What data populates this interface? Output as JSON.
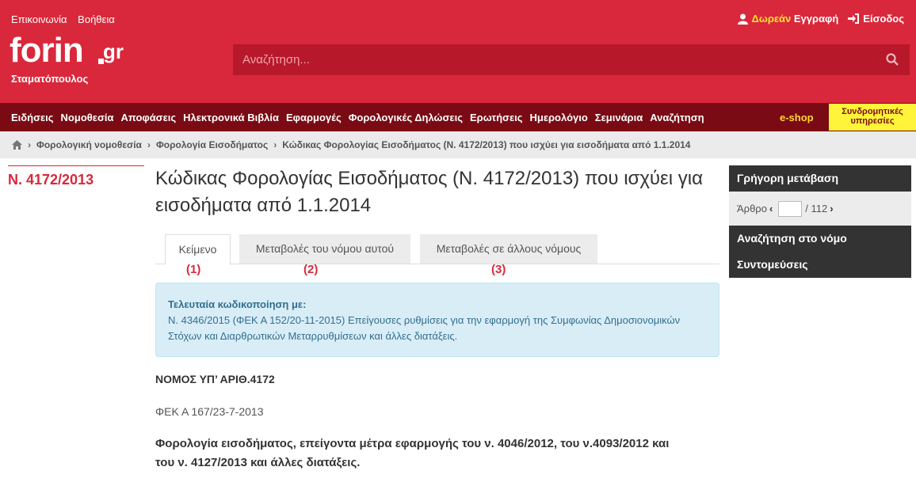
{
  "header": {
    "top_links": [
      "Επικοινωνία",
      "Βοήθεια"
    ],
    "register_free": "Δωρεάν",
    "register": "Εγγραφή",
    "login": "Είσοδος",
    "logo_word": "forin",
    "logo_tld": "gr",
    "logo_sub": "Σταματόπουλος",
    "search_placeholder": "Αναζήτηση..."
  },
  "nav": {
    "items": [
      "Ειδήσεις",
      "Νομοθεσία",
      "Αποφάσεις",
      "Ηλεκτρονικά Βιβλία",
      "Εφαρμογές",
      "Φορολογικές Δηλώσεις",
      "Ερωτήσεις",
      "Ημερολόγιο",
      "Σεμινάρια",
      "Αναζήτηση"
    ],
    "eshop": "e-shop",
    "subscriptions": "Συνδρομητικές υπηρεσίες"
  },
  "breadcrumb": [
    "Φορολογική νομοθεσία",
    "Φορολογία Εισοδήματος",
    "Κώδικας Φορολογίας Εισοδήματος (Ν. 4172/2013) που ισχύει για εισοδήματα από 1.1.2014"
  ],
  "law_id": "Ν. 4172/2013",
  "title": "Κώδικας Φορολογίας Εισοδήματος (Ν. 4172/2013) που ισχύει για εισοδήματα από 1.1.2014",
  "tabs": [
    {
      "label": "Κείμενο",
      "num": "(1)"
    },
    {
      "label": "Μεταβολές του νόμου αυτού",
      "num": "(2)"
    },
    {
      "label": "Μεταβολές σε άλλους νόμους",
      "num": "(3)"
    }
  ],
  "info": {
    "label": "Τελευταία κωδικοποίηση με:",
    "text": "Ν. 4346/2015 (ΦΕΚ Α 152/20-11-2015) Επείγουσες ρυθμίσεις για την εφαρμογή της Συμφωνίας Δημοσιονομικών Στόχων και Διαρθρωτικών Μεταρρυθμίσεων και άλλες διατάξεις."
  },
  "body": {
    "law_number": "ΝΟΜΟΣ ΥΠ’ ΑΡΙΘ.4172",
    "fek": "ΦΕΚ Α 167/23-7-2013",
    "subject": "Φορολογία εισοδήματος, επείγοντα μέτρα εφαρμογής του ν. 4046/2012, του ν.4093/2012 και του ν. 4127/2013 και άλλες διατάξεις."
  },
  "sidebar": {
    "quick_nav": "Γρήγορη μετάβαση",
    "article_label": "Άρθρο",
    "article_total": "/ 112",
    "search_in_law": "Αναζήτηση στο νόμο",
    "shortcuts": "Συντομεύσεις"
  },
  "colors": {
    "brand_red": "#d9283b",
    "nav_dark": "#7a0b14",
    "accent_yellow": "#fff43a"
  }
}
